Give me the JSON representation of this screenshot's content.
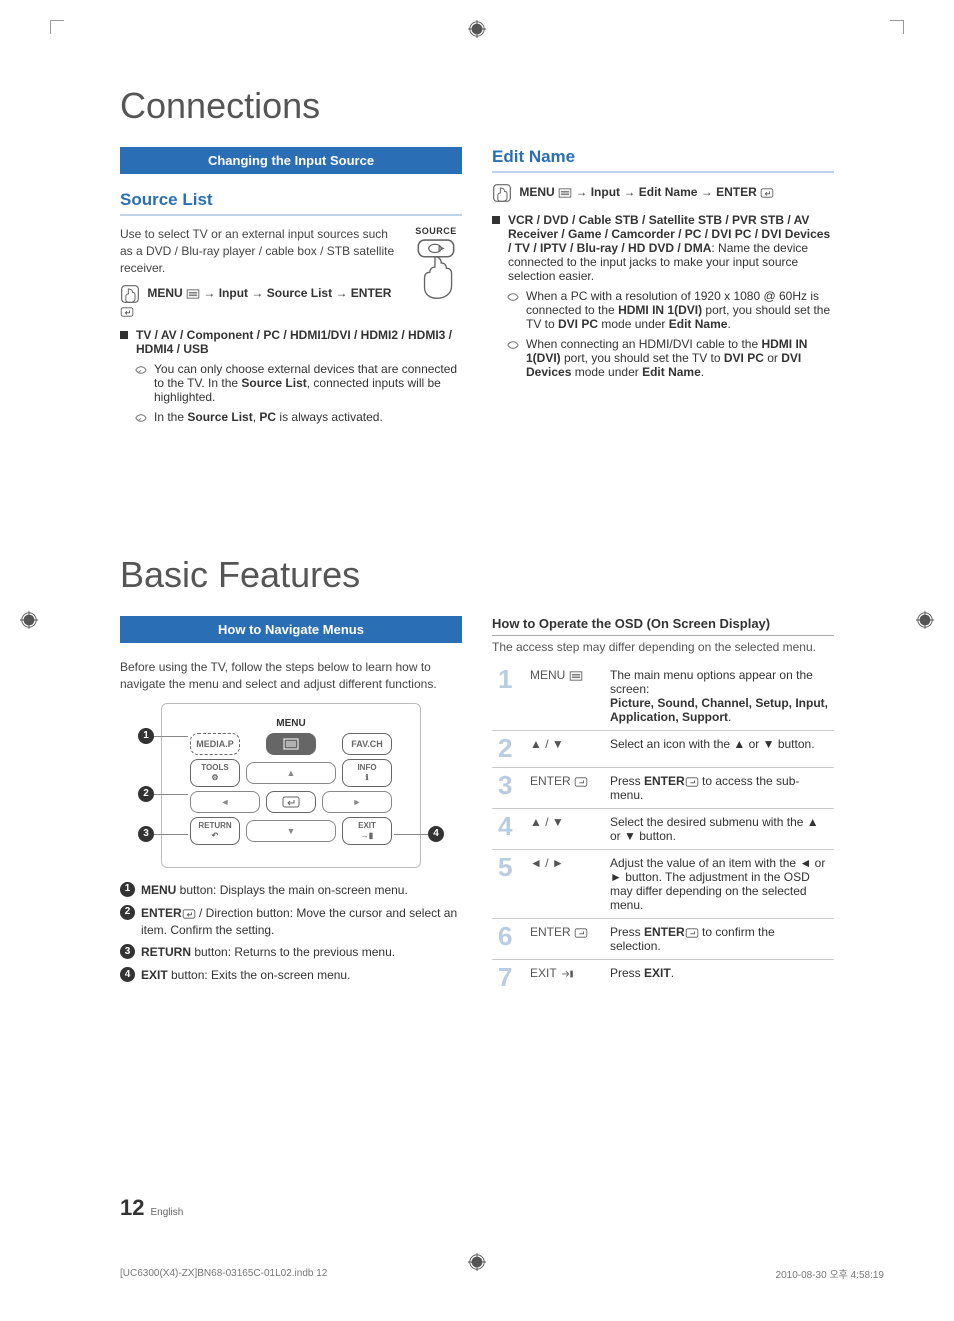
{
  "titles": {
    "connections": "Connections",
    "basic_features": "Basic Features"
  },
  "connections": {
    "pill": "Changing the Input Source",
    "source_list": {
      "heading": "Source List",
      "intro": "Use to select TV or an external input sources such as a DVD / Blu-ray player / cable box / STB satellite receiver.",
      "path": [
        "MENU",
        "→",
        "Input",
        "→",
        "Source List",
        "→",
        "ENTER"
      ],
      "source_btn_label": "SOURCE",
      "bullet_bold": "TV / AV / Component / PC / HDMI1/DVI / HDMI2 / HDMI3 / HDMI4 / USB",
      "note1_a": "You can only choose external devices that are connected to the TV. In the ",
      "note1_b": "Source List",
      "note1_c": ", connected inputs will be highlighted.",
      "note2_a": "In the ",
      "note2_b": "Source List",
      "note2_c": ", ",
      "note2_d": "PC",
      "note2_e": " is always activated."
    },
    "edit_name": {
      "heading": "Edit Name",
      "path": [
        "MENU",
        "→",
        "Input",
        "→",
        "Edit Name",
        "→",
        "ENTER"
      ],
      "bullet_bold": "VCR / DVD / Cable STB / Satellite STB / PVR STB / AV Receiver / Game / Camcorder / PC / DVI PC / DVI Devices / TV / IPTV / Blu-ray / HD DVD / DMA",
      "bullet_tail": ": Name the device connected to the input jacks to make your input source selection easier.",
      "note1_a": "When a PC with a resolution of 1920 x 1080 @ 60Hz is connected to the ",
      "note1_b": "HDMI IN 1(DVI)",
      "note1_c": " port, you should set the TV to ",
      "note1_d": "DVI PC",
      "note1_e": " mode under ",
      "note1_f": "Edit Name",
      "note1_g": ".",
      "note2_a": "When connecting an HDMI/DVI cable to the ",
      "note2_b": "HDMI IN 1(DVI)",
      "note2_c": " port, you should set the TV to ",
      "note2_d": "DVI PC",
      "note2_e": " or ",
      "note2_f": "DVI Devices",
      "note2_g": " mode under ",
      "note2_h": "Edit Name",
      "note2_i": "."
    }
  },
  "basic": {
    "pill": "How to Navigate Menus",
    "intro": "Before using the TV, follow the steps below to learn how to navigate the menu and select and adjust different functions.",
    "remote": {
      "menu_label": "MENU",
      "media_p": "MEDIA.P",
      "favch": "FAV.CH",
      "tools": "TOOLS",
      "info": "INFO",
      "return": "RETURN",
      "exit": "EXIT"
    },
    "numbered": {
      "one_a": "MENU",
      "one_b": " button: Displays the main on-screen menu.",
      "two_a": "ENTER",
      "two_b": " / Direction button: Move the cursor and select an item. Confirm the setting.",
      "three_a": "RETURN",
      "three_b": " button: Returns to the previous menu.",
      "four_a": "EXIT",
      "four_b": " button: Exits the on-screen menu."
    },
    "osd": {
      "heading": "How to Operate the OSD (On Screen Display)",
      "sub": "The access step may differ depending on the selected menu.",
      "rows": [
        {
          "n": "1",
          "key": "MENU",
          "keysym": "m",
          "text_a": "The main menu options appear on the screen:",
          "text_b": "Picture, Sound, Channel, Setup, Input, Application, Support",
          "text_c": "."
        },
        {
          "n": "2",
          "key": "▲ / ▼",
          "text_a": "Select an icon with the ▲ or ▼ button."
        },
        {
          "n": "3",
          "key": "ENTER",
          "keysym": "E",
          "text_a": "Press ",
          "text_b": "ENTER",
          "text_c": " to access the sub-menu."
        },
        {
          "n": "4",
          "key": "▲ / ▼",
          "text_a": "Select the desired submenu with the ▲ or ▼ button."
        },
        {
          "n": "5",
          "key": "◄ / ►",
          "text_a": "Adjust the value of an item with the ◄ or ► button. The adjustment in the OSD may differ depending on the selected menu."
        },
        {
          "n": "6",
          "key": "ENTER",
          "keysym": "E",
          "text_a": "Press ",
          "text_b": "ENTER",
          "text_c": " to confirm the selection."
        },
        {
          "n": "7",
          "key": "EXIT",
          "keysym": "→",
          "text_a": "Press ",
          "text_b": "EXIT",
          "text_c": "."
        }
      ]
    }
  },
  "footer": {
    "file": "[UC6300(X4)-ZX]BN68-03165C-01L02.indb   12",
    "date": "2010-08-30   오후 4:58:19",
    "pagenum": "12",
    "lang": "English"
  }
}
